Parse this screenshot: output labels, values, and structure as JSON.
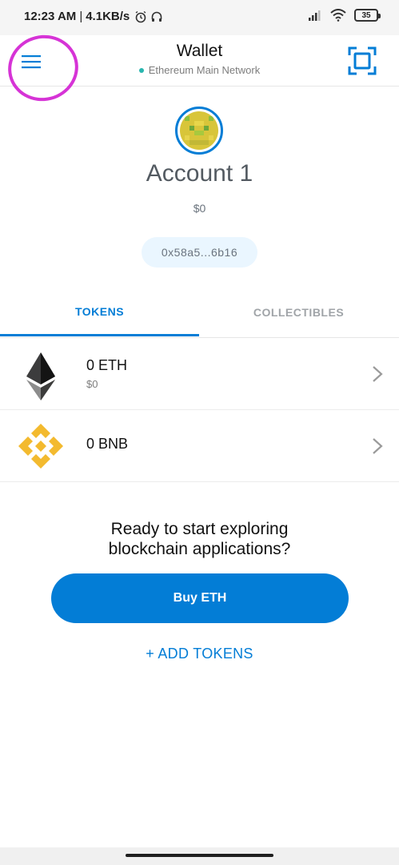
{
  "status_bar": {
    "time": "12:23 AM",
    "separator": "|",
    "speed": "4.1KB/s",
    "battery": "35"
  },
  "header": {
    "title": "Wallet",
    "network": "Ethereum Main Network"
  },
  "account": {
    "name": "Account 1",
    "balance": "$0",
    "address": "0x58a5...6b16"
  },
  "tabs": {
    "tokens": "TOKENS",
    "collectibles": "COLLECTIBLES"
  },
  "tokens": [
    {
      "amount": "0 ETH",
      "fiat": "$0",
      "icon": "ethereum-logo-icon"
    },
    {
      "amount": "0 BNB",
      "icon": "binance-logo-icon"
    }
  ],
  "empty_state": {
    "line1": "Ready to start exploring",
    "line2": "blockchain applications?"
  },
  "actions": {
    "buy": "Buy ETH",
    "add_tokens": "+ ADD TOKENS"
  },
  "colors": {
    "accent": "#037dd6",
    "network_dot": "#29b6af",
    "annotation": "#d633d6",
    "bnb": "#f3ba2f"
  }
}
